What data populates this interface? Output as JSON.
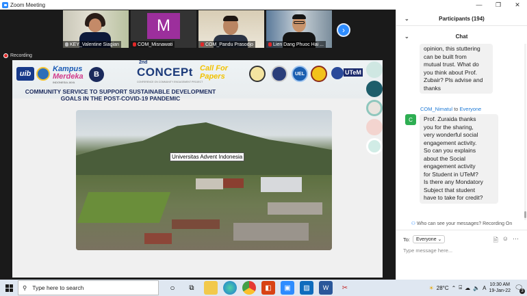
{
  "window": {
    "title": "Zoom Meeting",
    "controls": [
      "—",
      "❐",
      "✕"
    ]
  },
  "participants_strip": [
    {
      "name": "KEY_Valentine Siagian",
      "mic": "off",
      "active": true
    },
    {
      "name": "COM_Misnawati",
      "mic": "on",
      "avatar_letter": "M"
    },
    {
      "name": "COM_Pandu Prasodjo",
      "mic": "on"
    },
    {
      "name": "Lien Dang Phuoc Hai ...",
      "mic": "on"
    }
  ],
  "next_button": "›",
  "recording_label": "Recording",
  "slide": {
    "logos": {
      "uib": "uib",
      "kampus": "Kampus",
      "merdeka": "Merdeka",
      "merdeka_sub": "INDONESIA JAYA",
      "concept_top": "2nd",
      "concept": "CONCEPt",
      "concept_sub": "CONFERENCE ON COMMUNITY ENGAGEMENT PROJECT",
      "call1": "Call For",
      "call2": "Papers",
      "uel": "UEL",
      "utem": "UTeM"
    },
    "title_line1": "COMMUNITY SERVICE TO SUPPORT SUSTAINABLE DEVELOPMENT",
    "title_line2": "GOALS IN THE POST-COVID-19 PANDEMIC",
    "photo_caption": "Universitas Advent Indonesia"
  },
  "panel": {
    "participants_header": "Participants (194)",
    "chat_header": "Chat",
    "messages": [
      {
        "text_lines": [
          "opinion, this stuttering",
          "can be built from",
          "mutual trust.  What do",
          "you think about Prof.",
          "Zubair? Pls advise and",
          "thanks"
        ]
      },
      {
        "sender": "COM_Nimatul",
        "to_word": "to",
        "recipient": "Everyone",
        "avatar_letter": "C",
        "text_lines": [
          "Prof. Zuraida thanks",
          "you for the sharing,",
          "very wonderful social",
          "engagement activity.",
          "So can you explains",
          "about the Social",
          "engagement activity",
          "for Student in UTeM?",
          "Is there any Mondatory",
          "Subject that student",
          "have to take for credit?"
        ]
      }
    ],
    "who_can_see": "Who can see your messages? Recording On",
    "to_label": "To:",
    "to_value": "Everyone",
    "input_placeholder": "Type message here..."
  },
  "taskbar": {
    "search_placeholder": "Type here to search",
    "weather": "28°C",
    "time": "10:30 AM",
    "date": "19-Jan-22",
    "notification_count": "3"
  },
  "colors": {
    "zoom_blue": "#2d8cff",
    "recording_red": "#e02828",
    "chat_green": "#2eae52",
    "sender_blue": "#1e7ad6"
  }
}
